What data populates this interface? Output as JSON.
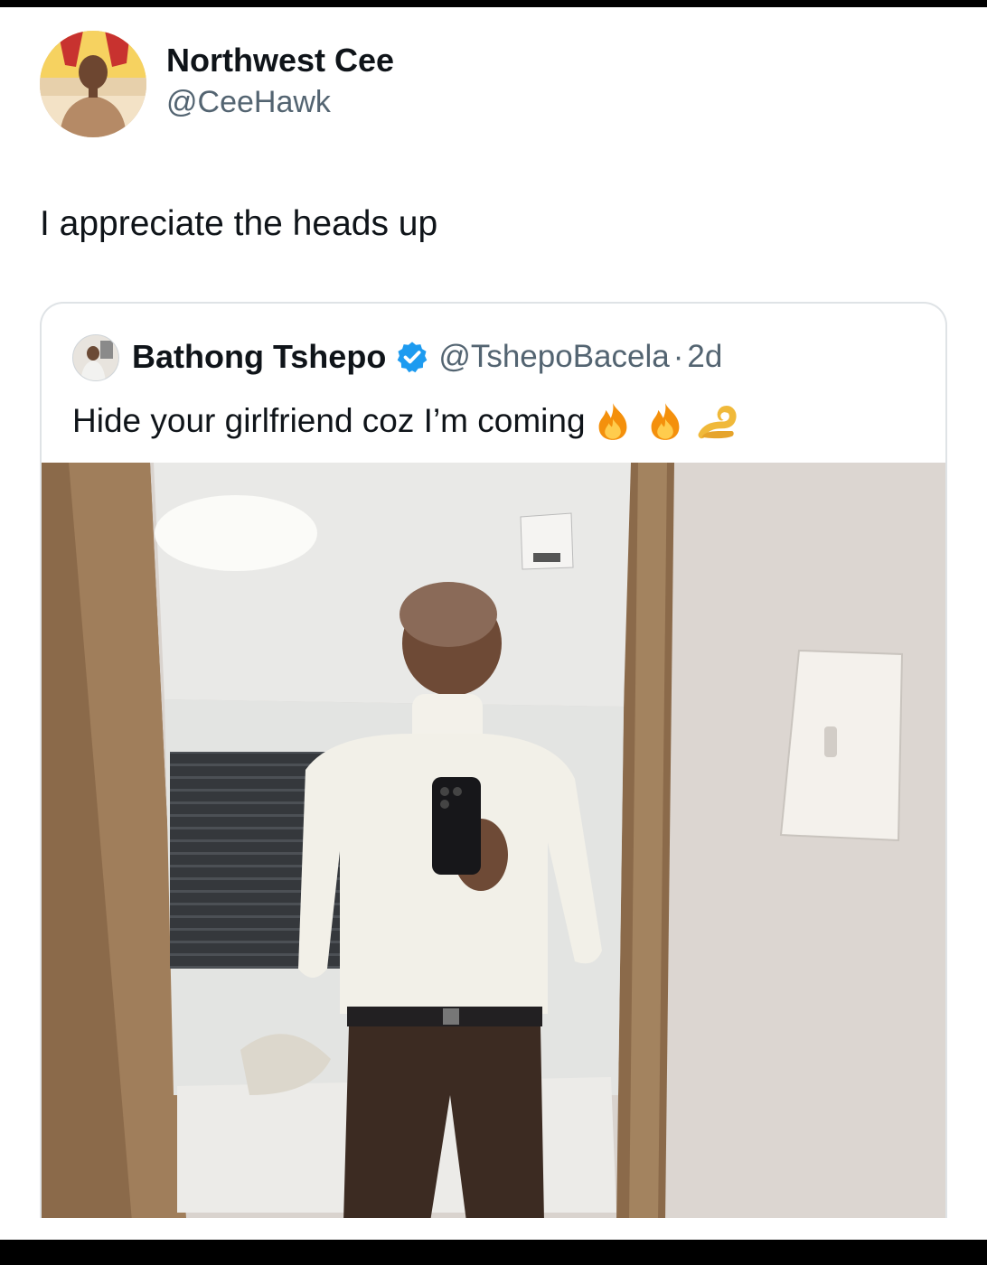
{
  "tweet": {
    "author_name": "Northwest Cee",
    "author_handle": "@CeeHawk",
    "text": "I appreciate the heads up"
  },
  "quoted_tweet": {
    "author_name": "Bathong Tshepo",
    "verified": true,
    "author_handle": "@TshepoBacela",
    "separator": "·",
    "time": "2d",
    "text": "Hide your girlfriend coz I’m coming",
    "emojis": [
      "fire-icon",
      "fire-icon",
      "ok-hand-icon"
    ]
  },
  "colors": {
    "text_primary": "#0f1419",
    "text_secondary": "#536471",
    "verified_blue": "#1d9bf0",
    "card_border": "#dfe3e6"
  }
}
